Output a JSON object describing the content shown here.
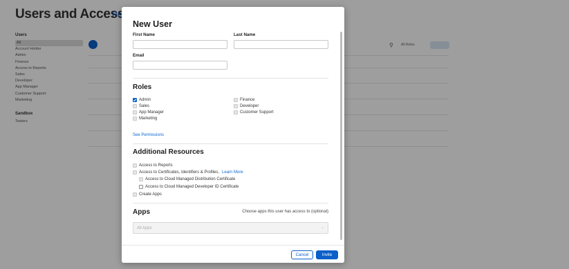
{
  "background": {
    "title": "Users and Access",
    "active_tab": "Peo",
    "nav_people_header": "Users",
    "nav_people_items": [
      "All",
      "Account Holder",
      "Admin",
      "Finance",
      "Access to Reports",
      "Sales",
      "Developer",
      "App Manager",
      "Customer Support",
      "Marketing"
    ],
    "nav_sandbox_header": "Sandbox",
    "nav_sandbox_items": [
      "Testers"
    ],
    "search_icon": "search-icon",
    "filter_label": "All Roles",
    "edit_label": "Edit",
    "rows": [
      "r1",
      "r2",
      "r3",
      "r4",
      "r5",
      "r6"
    ]
  },
  "modal": {
    "title": "New User",
    "first_name_label": "First Name",
    "first_name_value": "",
    "last_name_label": "Last Name",
    "last_name_value": "",
    "email_label": "Email",
    "email_value": "",
    "roles_title": "Roles",
    "roles": [
      {
        "label": "Admin",
        "checked": true
      },
      {
        "label": "Sales",
        "checked": false
      },
      {
        "label": "App Manager",
        "checked": false
      },
      {
        "label": "Marketing",
        "checked": false
      },
      {
        "label": "Finance",
        "checked": false
      },
      {
        "label": "Developer",
        "checked": false
      },
      {
        "label": "Customer Support",
        "checked": false
      }
    ],
    "see_permissions": "See Permissions",
    "resources_title": "Additional Resources",
    "resources": {
      "access_reports": "Access to Reports",
      "access_certs": "Access to Certificates, Identifiers & Profiles.",
      "learn_more": "Learn More",
      "cloud_distribution": "Access to Cloud Managed Distribution Certificate",
      "cloud_developer_id": "Access to Cloud Managed Developer ID Certificate",
      "create_apps": "Create Apps"
    },
    "apps_title": "Apps",
    "apps_hint": "Choose apps this user has access to (optional)",
    "apps_select_value": "All Apps",
    "cancel_label": "Cancel",
    "invite_label": "Invite"
  },
  "colors": {
    "accent": "#0a5fc8",
    "link": "#0a67d1",
    "overlay": "rgba(0,0,0,0.38)"
  }
}
